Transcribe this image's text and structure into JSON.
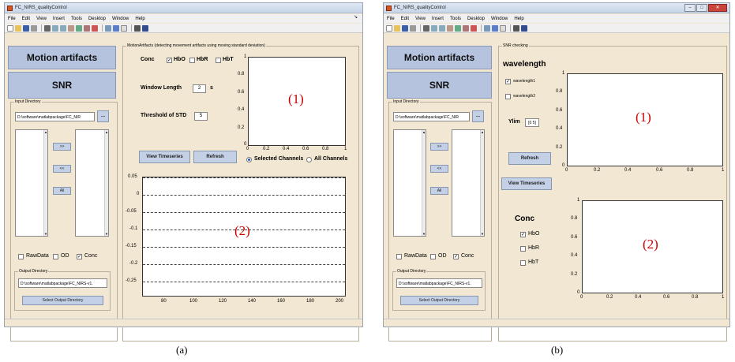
{
  "window_a": {
    "title": "FC_NIRS_qualityControl",
    "menu": [
      "File",
      "Edit",
      "View",
      "Insert",
      "Tools",
      "Desktop",
      "Window",
      "Help"
    ],
    "menu_arrow": "↘",
    "tabs": {
      "motion": "Motion artifacts",
      "snr": "SNR"
    },
    "input_directory": {
      "title": "Input Directory",
      "path": "D:\\software\\matlabpackage\\FC_NIR",
      "browse": "..."
    },
    "list_buttons": [
      ">>",
      "<<",
      "All"
    ],
    "data_types": [
      {
        "label": "RawData",
        "checked": false
      },
      {
        "label": "OD",
        "checked": false
      },
      {
        "label": "Conc",
        "checked": true
      }
    ],
    "output_directory": {
      "title": "Output Directory",
      "path": "D:\\software\\matlabpackage\\FC_NIRS-v1.",
      "button": "Select Output Directory"
    },
    "motion_panel": {
      "title": "MotionArtifacts (detecting movement artifacts using moving standard deviation)",
      "conc_label": "Conc",
      "conc_options": [
        {
          "label": "HbO",
          "checked": true
        },
        {
          "label": "HbR",
          "checked": false
        },
        {
          "label": "HbT",
          "checked": false
        }
      ],
      "window_length_label": "Window Length",
      "window_length_value": "2",
      "window_length_unit": "s",
      "threshold_label": "Threshold of STD",
      "threshold_value": "5",
      "view_button": "View Timeseries",
      "refresh_button": "Refresh",
      "radio": [
        {
          "label": "Selected Channels",
          "checked": true
        },
        {
          "label": "All Channels",
          "checked": false
        }
      ]
    },
    "plot1": {
      "marker": "(1)",
      "yticks": [
        "1",
        "0.8",
        "0.6",
        "0.4",
        "0.2",
        "0"
      ],
      "xticks": [
        "0",
        "0.2",
        "0.4",
        "0.6",
        "0.8",
        "1"
      ]
    },
    "plot2": {
      "marker": "(2)",
      "yticks": [
        "0.05",
        "0",
        "-0.05",
        "-0.1",
        "-0.15",
        "-0.2",
        "-0.25"
      ],
      "xticks": [
        "80",
        "100",
        "120",
        "140",
        "160",
        "180",
        "200"
      ]
    }
  },
  "window_b": {
    "title": "FC_NIRS_qualityControl",
    "menu": [
      "File",
      "Edit",
      "View",
      "Insert",
      "Tools",
      "Desktop",
      "Window",
      "Help"
    ],
    "tabs": {
      "motion": "Motion artifacts",
      "snr": "SNR"
    },
    "input_directory": {
      "title": "Input Directory",
      "path": "D:\\software\\matlabpackage\\FC_NIR",
      "browse": "..."
    },
    "list_buttons": [
      ">>",
      "<<",
      "All"
    ],
    "data_types": [
      {
        "label": "RawData",
        "checked": false
      },
      {
        "label": "OD",
        "checked": false
      },
      {
        "label": "Conc",
        "checked": true
      }
    ],
    "output_directory": {
      "title": "Output Directory",
      "path": "D:\\software\\matlabpackage\\FC_NIRS-v1.",
      "button": "Select Output Directory"
    },
    "snr_panel": {
      "title": "SNR checking",
      "wavelength_label": "wavelength",
      "wavelengths": [
        {
          "label": "wavelength1",
          "checked": true
        },
        {
          "label": "wavelength2",
          "checked": false
        }
      ],
      "ylim_label": "Ylim",
      "ylim_value": "[0 5]",
      "refresh_button": "Refresh",
      "view_button": "View Timeseries",
      "conc_label": "Conc",
      "conc_options": [
        {
          "label": "HbO",
          "checked": true
        },
        {
          "label": "HbR",
          "checked": false
        },
        {
          "label": "HbT",
          "checked": false
        }
      ]
    },
    "plot1": {
      "marker": "(1)",
      "yticks": [
        "1",
        "0.8",
        "0.6",
        "0.4",
        "0.2",
        "0"
      ],
      "xticks": [
        "0",
        "0.2",
        "0.4",
        "0.6",
        "0.8",
        "1"
      ]
    },
    "plot2": {
      "marker": "(2)",
      "yticks": [
        "1",
        "0.8",
        "0.6",
        "0.4",
        "0.2",
        "0"
      ],
      "xticks": [
        "0",
        "0.2",
        "0.4",
        "0.6",
        "0.8",
        "1"
      ]
    }
  },
  "captions": {
    "a": "(a)",
    "b": "(b)"
  }
}
